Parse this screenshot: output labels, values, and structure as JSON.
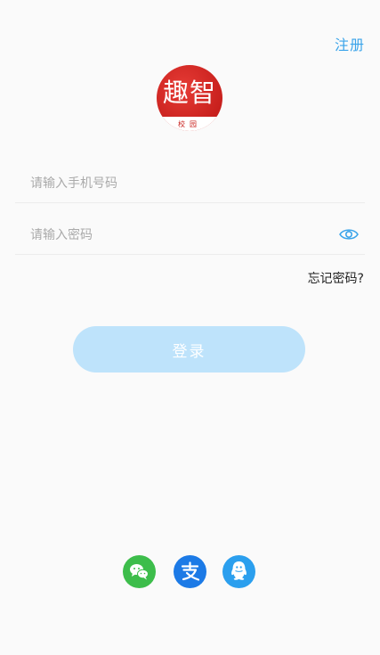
{
  "header": {
    "register_label": "注册"
  },
  "logo": {
    "title": "趣智",
    "subtitle": "校园"
  },
  "form": {
    "phone_placeholder": "请输入手机号码",
    "phone_value": "",
    "password_placeholder": "请输入密码",
    "password_value": "",
    "forgot_label": "忘记密码?"
  },
  "actions": {
    "login_label": "登录"
  },
  "social": {
    "icons": [
      "wechat-icon",
      "alipay-icon",
      "qq-icon"
    ],
    "colors": {
      "wechat": "#3dbd4b",
      "alipay": "#1c7ae6",
      "qq": "#2b9fee"
    }
  },
  "theme": {
    "accent": "#3aa4ea",
    "button_disabled": "#bee3fb",
    "logo_red": "#c8201d"
  }
}
